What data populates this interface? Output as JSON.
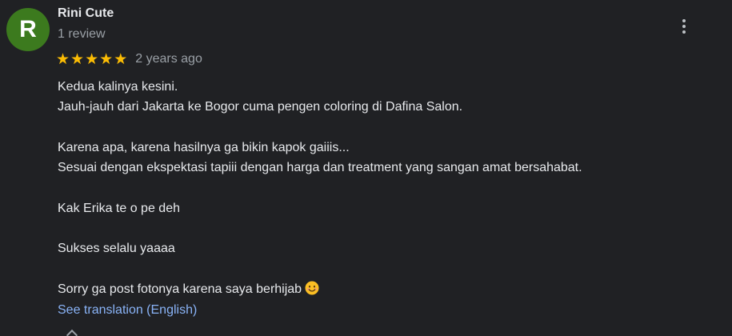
{
  "review": {
    "avatar_letter": "R",
    "avatar_color": "#3c7a1e",
    "author": "Rini Cute",
    "review_count": "1 review",
    "rating": 5,
    "rating_max": 5,
    "star_glyph": "★",
    "star_color": "#fbbc04",
    "age": "2 years ago",
    "more_icon": "more-vertical-icon",
    "text_lines": [
      "Kedua kalinya kesini.",
      "Jauh-jauh dari Jakarta ke Bogor cuma pengen coloring di Dafina Salon.",
      "",
      "Karena apa, karena hasilnya ga bikin kapok gaiiis...",
      "Sesuai dengan ekspektasi tapiii dengan harga dan treatment yang sangan amat bersahabat.",
      "",
      "Kak Erika te o pe deh",
      "",
      "Sukses selalu yaaaa",
      "",
      "Sorry ga post fotonya karena saya berhijab"
    ],
    "emoji_icon": "smiling-face-icon",
    "see_translation": "See translation (English)",
    "link_color": "#8ab4f8"
  }
}
